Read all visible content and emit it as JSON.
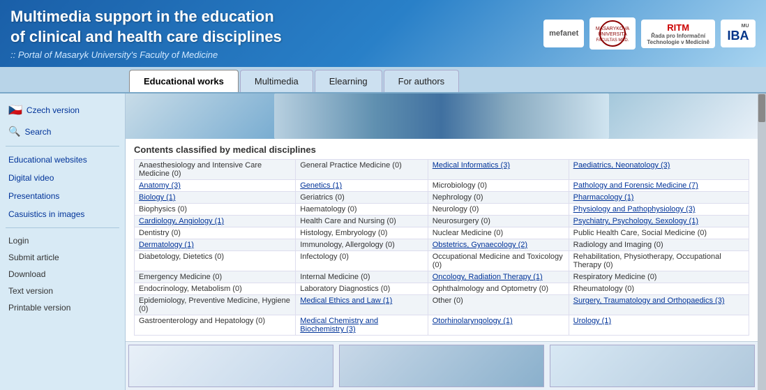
{
  "header": {
    "title_line1": "Multimedia support in the education",
    "title_line2": "of clinical and health care disciplines",
    "subtitle": ":: Portal of Masaryk University's Faculty of Medicine",
    "logos": {
      "mefanet": "mefanet",
      "mu": "MU",
      "ritm": "RITM",
      "iba": "IBA"
    }
  },
  "nav": {
    "tabs": [
      {
        "id": "educational-works",
        "label": "Educational works",
        "active": true
      },
      {
        "id": "multimedia",
        "label": "Multimedia",
        "active": false
      },
      {
        "id": "elearning",
        "label": "Elearning",
        "active": false
      },
      {
        "id": "for-authors",
        "label": "For authors",
        "active": false
      }
    ]
  },
  "sidebar": {
    "czech_version": "Czech version",
    "search": "Search",
    "sections": [
      "Educational websites",
      "Digital video",
      "Presentations",
      "Casuistics in images"
    ],
    "links": [
      "Login",
      "Submit article",
      "Download",
      "Text version",
      "Printable version"
    ]
  },
  "content": {
    "contents_title": "Contents classified by medical disciplines",
    "disciplines": [
      [
        "Anaesthesiology and Intensive Care Medicine (0)",
        "General Practice Medicine (0)",
        "Medical Informatics (3)",
        "Paediatrics, Neonatology (3)"
      ],
      [
        "Anatomy (3)",
        "Genetics (1)",
        "Microbiology (0)",
        "Pathology and Forensic Medicine (7)"
      ],
      [
        "Biology (1)",
        "Geriatrics (0)",
        "Nephrology (0)",
        "Pharmacology (1)"
      ],
      [
        "Biophysics (0)",
        "Haematology (0)",
        "Neurology (0)",
        "Physiology and Pathophysiology (3)"
      ],
      [
        "Cardiology, Angiology (1)",
        "Health Care and Nursing (0)",
        "Neurosurgery (0)",
        "Psychiatry, Psychology, Sexology (1)"
      ],
      [
        "Dentistry (0)",
        "Histology, Embryology (0)",
        "Nuclear Medicine (0)",
        "Public Health Care, Social Medicine (0)"
      ],
      [
        "Dermatology (1)",
        "Immunology, Allergology (0)",
        "Obstetrics, Gynaecology (2)",
        "Radiology and Imaging (0)"
      ],
      [
        "Diabetology, Dietetics (0)",
        "Infectology (0)",
        "Occupational Medicine and Toxicology (0)",
        "Rehabilitation, Physiotherapy, Occupational Therapy (0)"
      ],
      [
        "Emergency Medicine (0)",
        "Internal Medicine (0)",
        "Oncology, Radiation Therapy (1)",
        "Respiratory Medicine (0)"
      ],
      [
        "Endocrinology, Metabolism (0)",
        "Laboratory Diagnostics (0)",
        "Ophthalmology and Optometry (0)",
        "Rheumatology (0)"
      ],
      [
        "Epidemiology, Preventive Medicine, Hygiene (0)",
        "Medical Ethics and Law (1)",
        "Other (0)",
        "Surgery, Traumatology and Orthopaedics (3)"
      ],
      [
        "Gastroenterology and Hepatology (0)",
        "Medical Chemistry and Biochemistry (3)",
        "Otorhinolaryngology (1)",
        "Urology (1)"
      ]
    ],
    "linked_cells": [
      "Medical Informatics (3)",
      "Paediatrics, Neonatology (3)",
      "Anatomy (3)",
      "Genetics (1)",
      "Pathology and Forensic Medicine (7)",
      "Biology (1)",
      "Pharmacology (1)",
      "Physiology and Pathophysiology (3)",
      "Cardiology, Angiology (1)",
      "Psychiatry, Psychology, Sexology (1)",
      "Dermatology (1)",
      "Obstetrics, Gynaecology (2)",
      "Oncology, Radiation Therapy (1)",
      "Medical Ethics and Law (1)",
      "Medical Chemistry and Biochemistry (3)",
      "Otorhinolaryngology (1)",
      "Surgery, Traumatology and Orthopaedics (3)",
      "Urology (1)"
    ]
  }
}
